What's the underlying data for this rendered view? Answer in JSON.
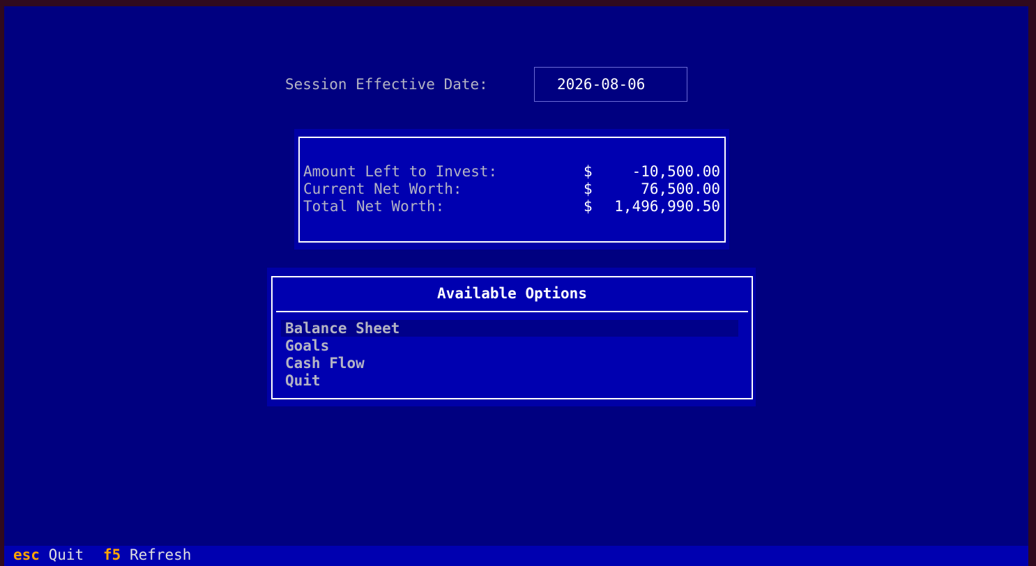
{
  "session": {
    "label": "Session Effective Date:",
    "date": "2026-08-06"
  },
  "summary": {
    "rows": [
      {
        "label": "Amount Left to Invest:",
        "currency": "$",
        "value": "-10,500.00"
      },
      {
        "label": "Current Net Worth:",
        "currency": "$",
        "value": "76,500.00"
      },
      {
        "label": "Total Net Worth:",
        "currency": "$",
        "value": "1,496,990.50"
      }
    ]
  },
  "options": {
    "title": "Available Options",
    "items": [
      {
        "label": "Balance Sheet",
        "selected": true
      },
      {
        "label": "Goals",
        "selected": false
      },
      {
        "label": "Cash Flow",
        "selected": false
      },
      {
        "label": "Quit",
        "selected": false
      }
    ]
  },
  "footer": {
    "bindings": [
      {
        "key": "esc",
        "action": "Quit"
      },
      {
        "key": "f5",
        "action": "Refresh"
      }
    ]
  },
  "colors": {
    "background": "#000080",
    "panel": "#0000b0",
    "accent_key": "#ffa500",
    "border": "#ffffff"
  }
}
